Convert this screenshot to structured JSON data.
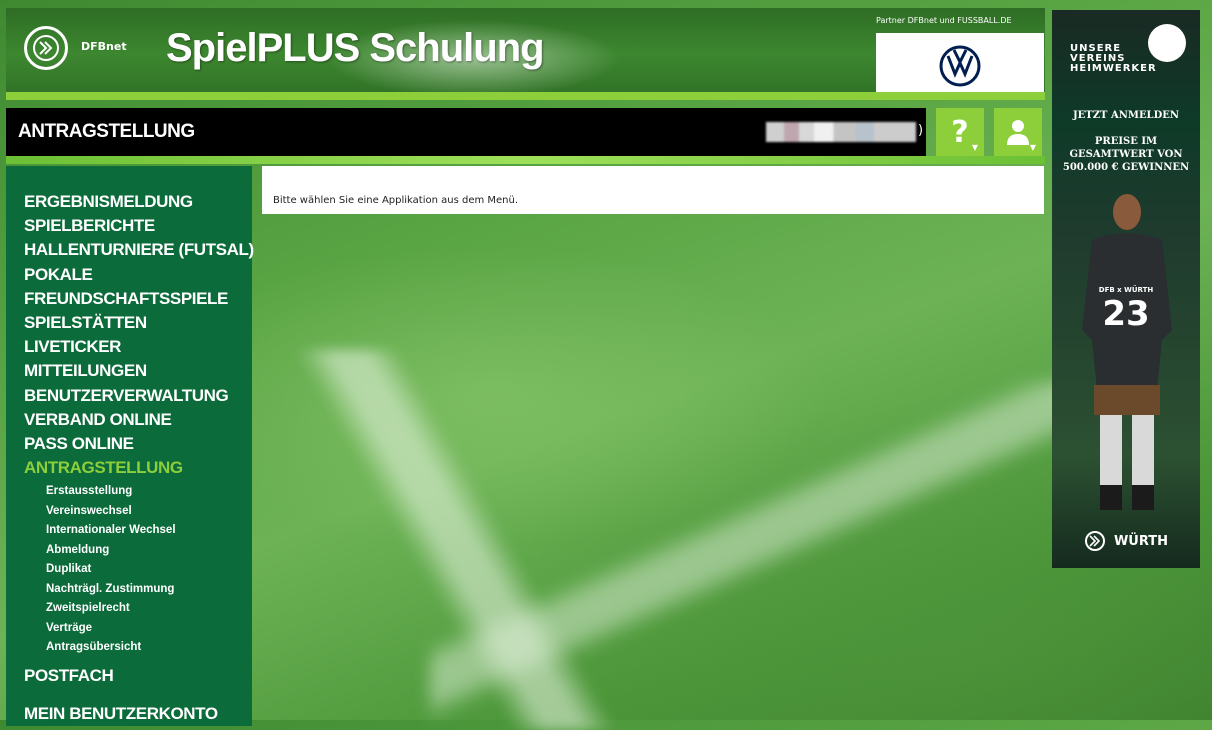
{
  "header": {
    "dfb_label": "DFBnet",
    "app_title": "SpielPLUS Schulung",
    "partner_text": "Partner DFBnet und FUSSBALL.DE"
  },
  "titlebar": {
    "page_title": "ANTRAGSTELLUNG",
    "user_suffix": ")",
    "help_label": "?"
  },
  "sidebar": {
    "items": [
      {
        "label": "ERGEBNISMELDUNG"
      },
      {
        "label": "SPIELBERICHTE"
      },
      {
        "label": "HALLENTURNIERE (FUTSAL)"
      },
      {
        "label": "POKALE"
      },
      {
        "label": "FREUNDSCHAFTSSPIELE"
      },
      {
        "label": "SPIELSTÄTTEN"
      },
      {
        "label": "LIVETICKER"
      },
      {
        "label": "MITTEILUNGEN"
      },
      {
        "label": "BENUTZERVERWALTUNG"
      },
      {
        "label": "VERBAND ONLINE"
      },
      {
        "label": "PASS ONLINE"
      },
      {
        "label": "ANTRAGSTELLUNG"
      }
    ],
    "subitems": [
      {
        "label": "Erstausstellung"
      },
      {
        "label": "Vereinswechsel"
      },
      {
        "label": "Internationaler Wechsel"
      },
      {
        "label": "Abmeldung"
      },
      {
        "label": "Duplikat"
      },
      {
        "label": "Nachträgl. Zustimmung"
      },
      {
        "label": "Zweitspielrecht"
      },
      {
        "label": "Verträge"
      },
      {
        "label": "Antragsübersicht"
      }
    ],
    "bottom_items": [
      {
        "label": "POSTFACH"
      },
      {
        "label": "MEIN BENUTZERKONTO"
      }
    ]
  },
  "content": {
    "message": "Bitte wählen Sie eine Applikation aus dem Menü."
  },
  "ad": {
    "logo_line1": "UNSERE",
    "logo_line2": "VEREINS",
    "logo_line3": "HEIMWERKER",
    "cta1": "JETZT ANMELDEN",
    "cta2": "PREISE IM",
    "cta3": "GESAMTWERT VON",
    "cta4": "500.000 € GEWINNEN",
    "shirt_text": "DFB x WÜRTH",
    "shirt_number": "23",
    "brand": "WÜRTH"
  },
  "colors": {
    "accent_green": "#8ccf3a",
    "sidebar_green": "#0c6b3b",
    "titlebar_black": "#000000"
  }
}
